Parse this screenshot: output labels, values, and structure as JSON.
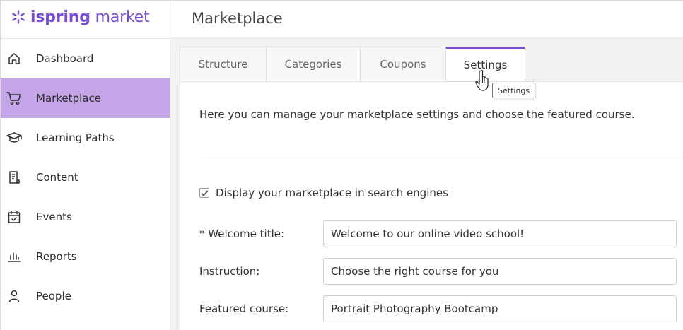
{
  "brand": {
    "name_bold": "ispring",
    "name_light": " market",
    "color": "#7b4fd6"
  },
  "sidebar": {
    "items": [
      {
        "label": "Dashboard",
        "icon": "home-icon"
      },
      {
        "label": "Marketplace",
        "icon": "cart-icon",
        "active": true
      },
      {
        "label": "Learning Paths",
        "icon": "graduation-cap-icon"
      },
      {
        "label": "Content",
        "icon": "document-icon"
      },
      {
        "label": "Events",
        "icon": "calendar-icon"
      },
      {
        "label": "Reports",
        "icon": "bar-chart-icon"
      },
      {
        "label": "People",
        "icon": "person-icon"
      }
    ],
    "active_color": "#c3a5e8"
  },
  "header": {
    "title": "Marketplace"
  },
  "tabs": [
    {
      "label": "Structure"
    },
    {
      "label": "Categories"
    },
    {
      "label": "Coupons"
    },
    {
      "label": "Settings",
      "active": true
    }
  ],
  "tooltip": {
    "text": "Settings"
  },
  "settings": {
    "description": "Here you can manage your marketplace settings and choose the featured course.",
    "search_engines_label": "Display your marketplace in search engines",
    "search_engines_checked": true,
    "fields": {
      "welcome_title": {
        "label": "* Welcome title:",
        "value": "Welcome to our online video school!"
      },
      "instruction": {
        "label": "Instruction:",
        "value": "Choose the right course for you"
      },
      "featured_course": {
        "label": "Featured course:",
        "value": "Portrait Photography Bootcamp"
      }
    }
  }
}
